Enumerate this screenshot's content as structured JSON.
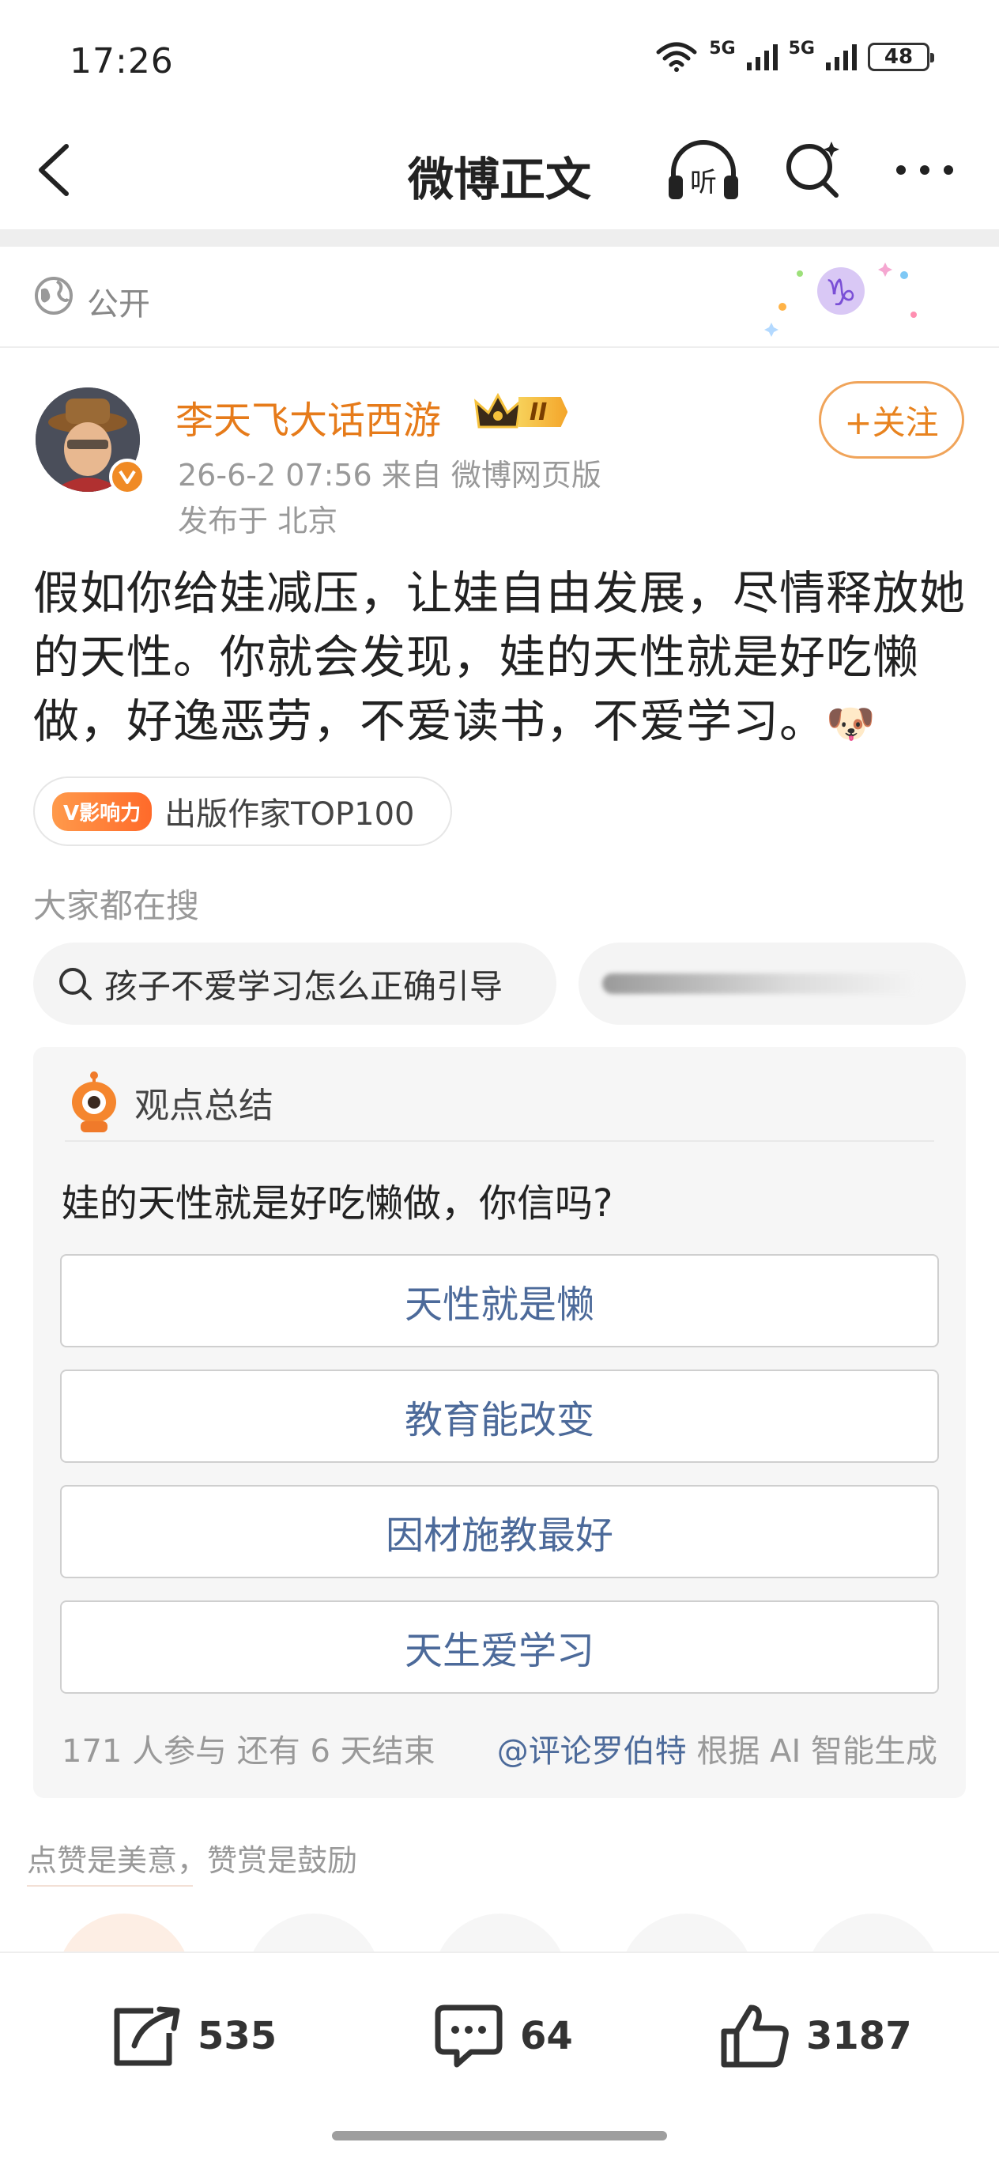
{
  "status_bar": {
    "time": "17:26",
    "network1": "5G",
    "network2": "5G",
    "battery": "48"
  },
  "nav": {
    "title": "微博正文",
    "listen_label": "听"
  },
  "visibility": {
    "label": "公开"
  },
  "author": {
    "name": "李天飞大话西游",
    "level_badge": "II",
    "meta": "26-6-2 07:56   来自 微博网页版",
    "location": "发布于 北京",
    "follow_label": "+关注"
  },
  "post": {
    "text": "假如你给娃减压，让娃自由发展，尽情释放她的天性。你就会发现，娃的天性就是好吃懒做，好逸恶劳，不爱读书，不爱学习。",
    "emoji": "🐶"
  },
  "influence": {
    "badge": "V影响力",
    "label": "出版作家TOP100"
  },
  "search": {
    "title": "大家都在搜",
    "chip1": "孩子不爱学习怎么正确引导"
  },
  "summary": {
    "title": "观点总结",
    "question": "娃的天性就是好吃懒做，你信吗?",
    "options": [
      "天性就是懒",
      "教育能改变",
      "因材施教最好",
      "天生爱学习"
    ],
    "participants": "171 人参与  还有 6 天结束",
    "mention": "@评论罗伯特",
    "ai_note": " 根据 AI 智能生成"
  },
  "reward": {
    "text": "点赞是美意，赞赏是鼓励"
  },
  "actions": {
    "repost": "535",
    "comment": "64",
    "like": "3187"
  },
  "colors": {
    "accent_orange": "#e67b1a",
    "link_blue": "#4c6a9a"
  }
}
